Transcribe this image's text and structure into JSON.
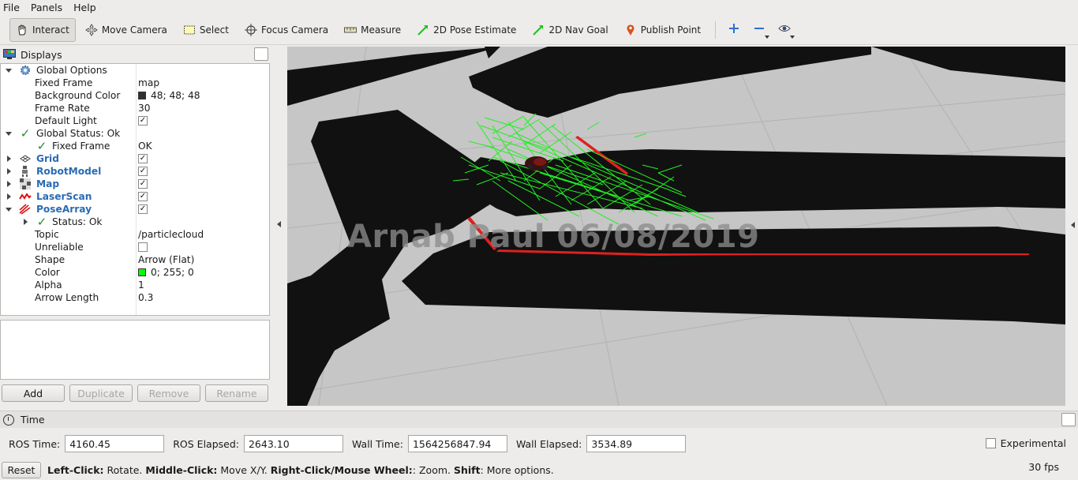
{
  "menu": {
    "file": "File",
    "panels": "Panels",
    "help": "Help"
  },
  "toolbar": {
    "interact": "Interact",
    "move_camera": "Move Camera",
    "select": "Select",
    "focus_camera": "Focus Camera",
    "measure": "Measure",
    "pose_estimate": "2D Pose Estimate",
    "nav_goal": "2D Nav Goal",
    "publish_point": "Publish Point"
  },
  "displays": {
    "title": "Displays",
    "rows": [
      {
        "label": "Global Options",
        "value": ""
      },
      {
        "label": "Fixed Frame",
        "value": "map"
      },
      {
        "label": "Background Color",
        "value": "48; 48; 48",
        "swatch": "#303030"
      },
      {
        "label": "Frame Rate",
        "value": "30"
      },
      {
        "label": "Default Light",
        "checked": true
      },
      {
        "label": "Global Status: Ok",
        "value": ""
      },
      {
        "label": "Fixed Frame",
        "value": "OK"
      },
      {
        "label": "Grid",
        "checked": true
      },
      {
        "label": "RobotModel",
        "checked": true
      },
      {
        "label": "Map",
        "checked": true
      },
      {
        "label": "LaserScan",
        "checked": true
      },
      {
        "label": "PoseArray",
        "checked": true
      },
      {
        "label": "Status: Ok",
        "value": ""
      },
      {
        "label": "Topic",
        "value": "/particlecloud"
      },
      {
        "label": "Unreliable",
        "checked": false
      },
      {
        "label": "Shape",
        "value": "Arrow (Flat)"
      },
      {
        "label": "Color",
        "value": "0; 255; 0",
        "swatch": "#00ff00"
      },
      {
        "label": "Alpha",
        "value": "1"
      },
      {
        "label": "Arrow Length",
        "value": "0.3"
      }
    ],
    "buttons": {
      "add": "Add",
      "duplicate": "Duplicate",
      "remove": "Remove",
      "rename": "Rename"
    }
  },
  "viewport": {
    "watermark": "Arnab Paul 06/08/2019"
  },
  "time": {
    "title": "Time",
    "ros_time_label": "ROS Time:",
    "ros_time": "4160.45",
    "ros_elapsed_label": "ROS Elapsed:",
    "ros_elapsed": "2643.10",
    "wall_time_label": "Wall Time:",
    "wall_time": "1564256847.94",
    "wall_elapsed_label": "Wall Elapsed:",
    "wall_elapsed": "3534.89",
    "experimental": "Experimental"
  },
  "status": {
    "reset": "Reset",
    "h1": "Left-Click:",
    "t1": " Rotate. ",
    "h2": "Middle-Click:",
    "t2": " Move X/Y. ",
    "h3": "Right-Click/Mouse Wheel:",
    "t3": ": Zoom. ",
    "h4": "Shift",
    "t4": ": More options.",
    "fps": "30 fps"
  }
}
